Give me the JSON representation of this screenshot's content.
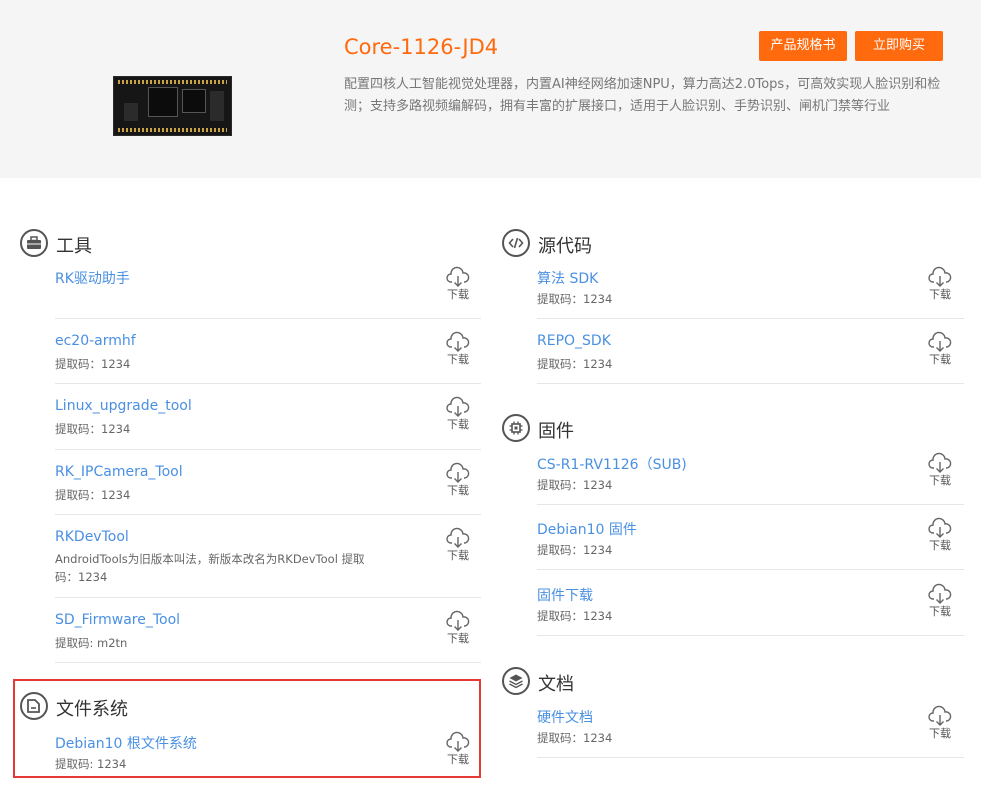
{
  "product": {
    "title": "Core-1126-JD4",
    "description": "配置四核人工智能视觉处理器，内置AI神经网络加速NPU，算力高达2.0Tops，可高效实现人脸识别和检测；支持多路视频编解码，拥有丰富的扩展接口，适用于人脸识别、手势识别、闸机门禁等行业",
    "spec_button": "产品规格书",
    "buy_button": "立即购买",
    "accent_color": "#ff6a0e"
  },
  "download_label": "下载",
  "left": {
    "tools": {
      "title": "工具",
      "icon": "toolbox-icon",
      "items": [
        {
          "name": "RK驱动助手",
          "sub": ""
        },
        {
          "name": "ec20-armhf",
          "sub": "提取码：1234"
        },
        {
          "name": "Linux_upgrade_tool",
          "sub": "提取码：1234"
        },
        {
          "name": "RK_IPCamera_Tool",
          "sub": "提取码：1234"
        },
        {
          "name": "RKDevTool",
          "sub": "AndroidTools为旧版本叫法，新版本改名为RKDevTool 提取码：1234"
        },
        {
          "name": "SD_Firmware_Tool",
          "sub": "提取码: m2tn"
        }
      ]
    },
    "filesystem": {
      "title": "文件系统",
      "icon": "folder-icon",
      "items": [
        {
          "name": "Debian10 根文件系统",
          "sub": "提取码: 1234"
        }
      ]
    }
  },
  "right": {
    "source": {
      "title": "源代码",
      "icon": "code-icon",
      "items": [
        {
          "name": "算法 SDK",
          "sub": "提取码：1234"
        },
        {
          "name": "REPO_SDK",
          "sub": "提取码：1234"
        }
      ]
    },
    "firmware": {
      "title": "固件",
      "icon": "chip-icon",
      "items": [
        {
          "name": "CS-R1-RV1126（SUB)",
          "sub": "提取码：1234"
        },
        {
          "name": "Debian10 固件",
          "sub": "提取码：1234"
        },
        {
          "name": "固件下载",
          "sub": "提取码：1234"
        }
      ]
    },
    "docs": {
      "title": "文档",
      "icon": "layers-icon",
      "items": [
        {
          "name": "硬件文档",
          "sub": "提取码：1234"
        }
      ]
    }
  }
}
